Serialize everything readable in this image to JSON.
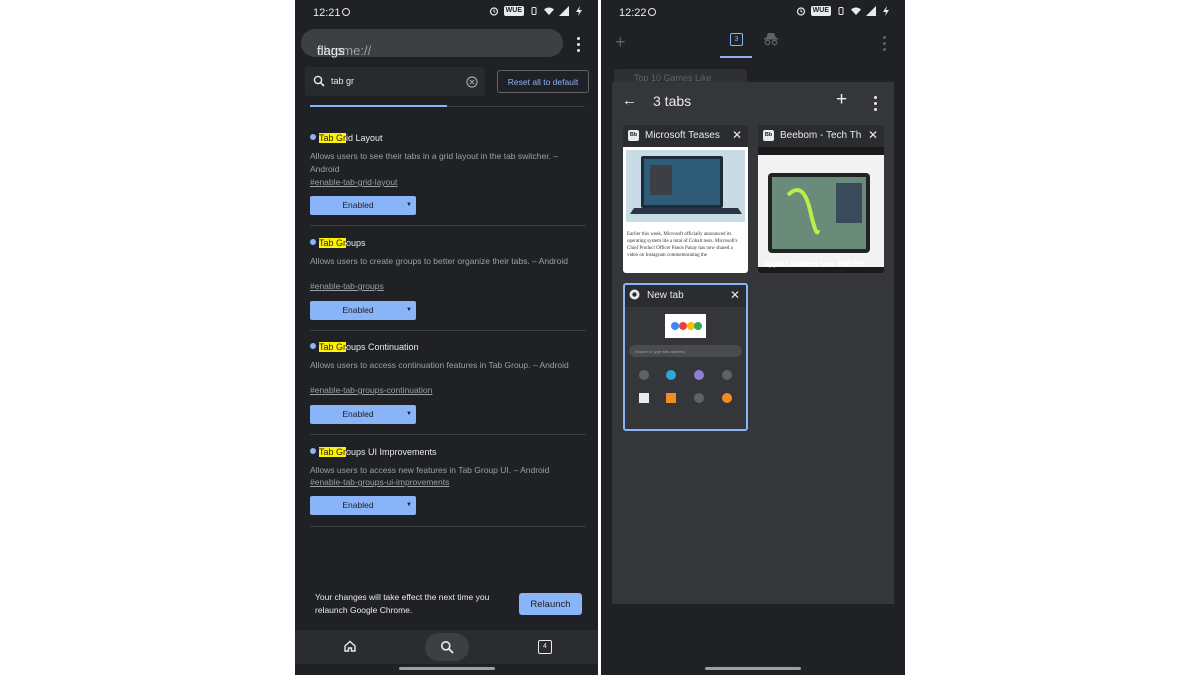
{
  "left": {
    "status": {
      "time": "12:21",
      "carrier_tag": "WUE"
    },
    "url": {
      "scheme": "chrome://",
      "host": "flags"
    },
    "search": {
      "value": "tab gr"
    },
    "reset_label": "Reset all to default",
    "flags": [
      {
        "hl": "Tab Gr",
        "rest": "id Layout",
        "desc": "Allows users to see their tabs in a grid layout in the tab switcher. – Android",
        "link": "#enable-tab-grid-layout",
        "value": "Enabled"
      },
      {
        "hl": "Tab Gr",
        "rest": "oups",
        "desc": "Allows users to create groups to better organize their tabs. – Android",
        "link": "#enable-tab-groups",
        "value": "Enabled"
      },
      {
        "hl": "Tab Gr",
        "rest": "oups Continuation",
        "desc": "Allows users to access continuation features in Tab Group. – Android",
        "link": "#enable-tab-groups-continuation",
        "value": "Enabled"
      },
      {
        "hl": "Tab Gr",
        "rest": "oups UI Improvements",
        "desc": "Allows users to access new features in Tab Group UI. – Android",
        "link": "#enable-tab-groups-ui-improvements",
        "value": "Enabled"
      }
    ],
    "relaunch": {
      "message": "Your changes will take effect the next time you relaunch Google Chrome.",
      "button": "Relaunch"
    },
    "tab_count": "4"
  },
  "right": {
    "status": {
      "time": "12:22",
      "carrier_tag": "WUE"
    },
    "tab_count": "3",
    "background_tab": "Top 10 Games Like",
    "group": {
      "title": "3 tabs",
      "tabs": [
        {
          "favicon": "Bb",
          "title": "Microsoft Teases",
          "thumb_text": "Earlier this week, Microsoft officially announced its operating system lite a total of Cobalt tests. Microsoft's Chief Product Officer Panos Panay has now shared a video on Instagram commemorating the"
        },
        {
          "favicon": "Bb",
          "title": "Beebom - Tech Th",
          "thumb_caption": "Apple Launches New iPad Pro"
        },
        {
          "favicon": "chrome",
          "title": "New tab",
          "omnibox": "Search or type web address"
        }
      ]
    }
  },
  "colors": {
    "background": "#202124",
    "surface": "#35363a",
    "accent": "#8ab4f8",
    "highlight": "#fff200",
    "text": "#e8eaed",
    "muted": "#9aa0a6"
  }
}
